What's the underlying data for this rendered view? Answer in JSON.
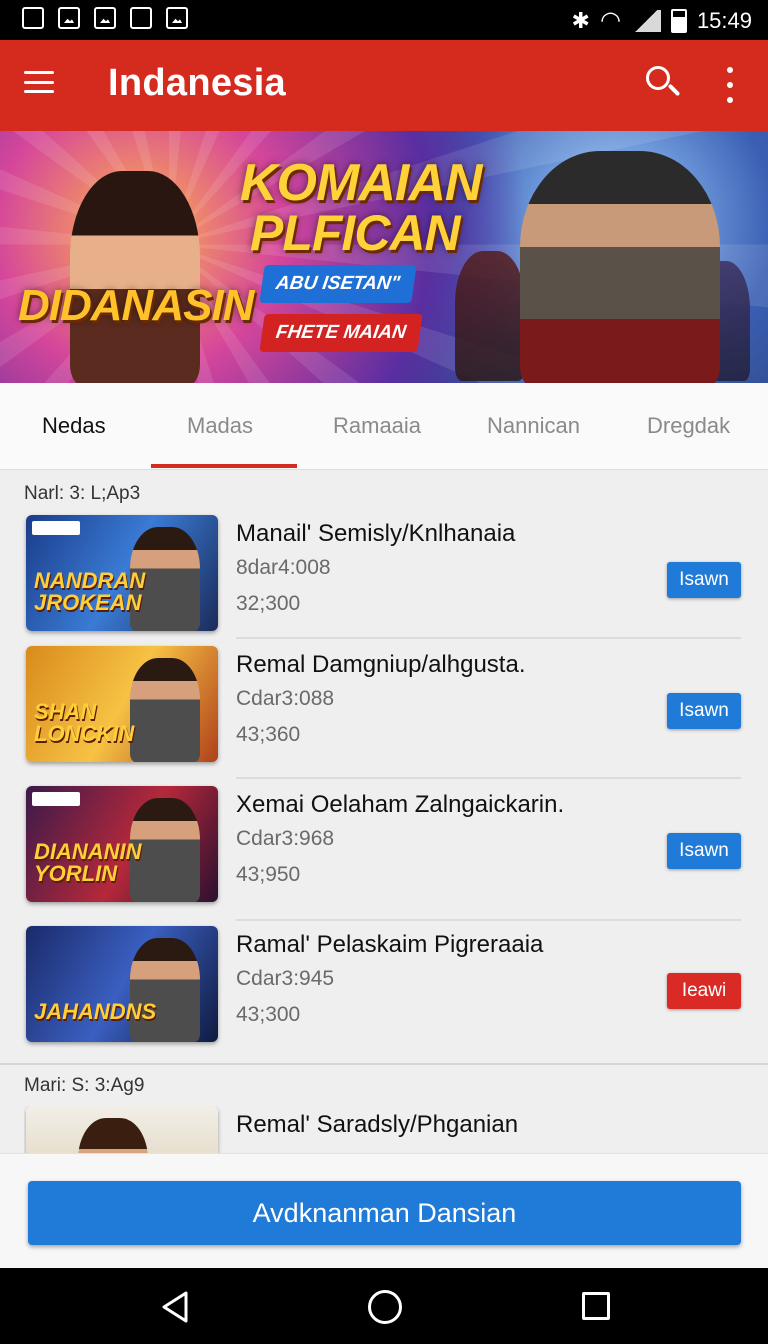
{
  "status_bar": {
    "time": "15:49"
  },
  "app_bar": {
    "title": "Indanesia"
  },
  "banner": {
    "title_line1": "KOMAIAN",
    "title_line2": "PLFICAN",
    "brand": "DIDANASIN",
    "pill1": "ABU ISETAN\"",
    "pill2": "FHETE MAIAN"
  },
  "tabs": [
    {
      "label": "Nedas",
      "active": false
    },
    {
      "label": "Madas",
      "active": true
    },
    {
      "label": "Ramaaia",
      "active": false
    },
    {
      "label": "Nannican",
      "active": false
    },
    {
      "label": "Dregdak",
      "active": false
    }
  ],
  "sections": [
    {
      "label": "Narl: 3: L;Ap3",
      "items": [
        {
          "thumb_text": "NANDRAN\nJROKEAN",
          "title": "Manail' Semisly/Knlhanaia",
          "sub1": "8dar4:008",
          "sub2": "32;300",
          "button": "Isawn",
          "button_color": "#1f7ad8"
        },
        {
          "thumb_text": "SHAN\nLONCKIN",
          "title": "Remal Damgniup/alhgusta.",
          "sub1": "Cdar3:088",
          "sub2": "43;360",
          "button": "Isawn",
          "button_color": "#1f7ad8"
        },
        {
          "thumb_text": "DIANANIN\nYORLIN",
          "title": "Xemai Oelaham Zalngaickarin.",
          "sub1": "Cdar3:968",
          "sub2": "43;950",
          "button": "Isawn",
          "button_color": "#1f7ad8"
        },
        {
          "thumb_text": "JAHANDNS",
          "title": "Ramal' Pelaskaim Pigreraaia",
          "sub1": "Cdar3:945",
          "sub2": "43;300",
          "button": "Ieawi",
          "button_color": "#d92a26"
        }
      ]
    },
    {
      "label": "Mari: S: 3:Ag9",
      "items": [
        {
          "title": "Remal' Saradsly/Phganian"
        }
      ]
    }
  ],
  "bottom_button": "Avdknanman Dansian"
}
